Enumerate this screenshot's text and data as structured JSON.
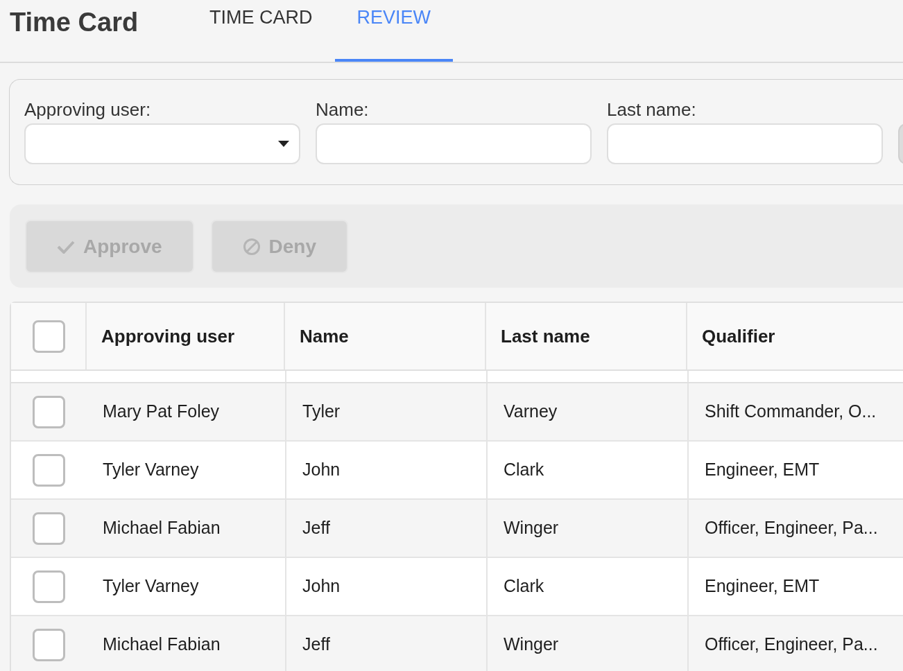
{
  "header": {
    "title": "Time Card"
  },
  "tabs": [
    {
      "label": "TIME CARD",
      "selected": false
    },
    {
      "label": "REVIEW",
      "selected": true
    }
  ],
  "filters": [
    {
      "label": "Approving user:",
      "kind": "dropdown"
    },
    {
      "label": "Name:",
      "kind": "text"
    },
    {
      "label": "Last name:",
      "kind": "text"
    },
    {
      "kind": "text"
    }
  ],
  "actions": [
    {
      "label": "Approve",
      "kind": "approve",
      "disabled": true
    },
    {
      "label": "Deny",
      "kind": "deny",
      "disabled": true
    }
  ],
  "table": {
    "select_all": {
      "checked": false
    },
    "columns": [
      "Approving user",
      "Name",
      "Last name",
      "Qualifier"
    ],
    "rows": [
      {
        "checked": false,
        "cells": [
          "Mary Pat Foley",
          "Tyler",
          "Varney",
          "Shift Commander, O..."
        ]
      },
      {
        "checked": false,
        "cells": [
          "Tyler Varney",
          "John",
          "Clark",
          "Engineer, EMT"
        ]
      },
      {
        "checked": false,
        "cells": [
          "Michael Fabian",
          "Jeff",
          "Winger",
          "Officer, Engineer, Pa..."
        ]
      },
      {
        "checked": false,
        "cells": [
          "Tyler Varney",
          "John",
          "Clark",
          "Engineer, EMT"
        ]
      },
      {
        "checked": false,
        "cells": [
          "Michael Fabian",
          "Jeff",
          "Winger",
          "Officer, Engineer, Pa..."
        ]
      }
    ]
  }
}
